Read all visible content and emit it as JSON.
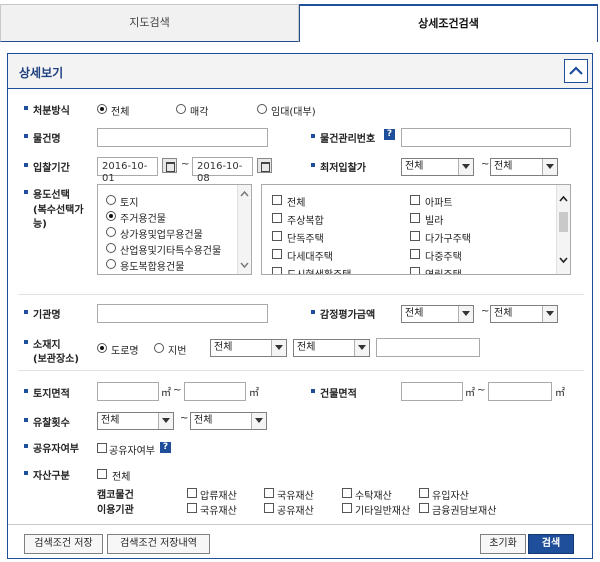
{
  "tabs": {
    "map": "지도검색",
    "detail": "상세조건검색"
  },
  "panel": {
    "title": "상세보기"
  },
  "disposal": {
    "label": "처분방식",
    "options": [
      "전체",
      "매각",
      "임대(대부)"
    ],
    "selected": 0
  },
  "item_name": {
    "label": "물건명",
    "value": ""
  },
  "item_no": {
    "label": "물건관리번호",
    "help": "?",
    "value": ""
  },
  "bid_period": {
    "label": "입찰기간",
    "from": "2016-10-01",
    "to": "2016-10-08",
    "tilde": "~"
  },
  "min_bid": {
    "label": "최저입찰가",
    "from": "전체",
    "to": "전체",
    "tilde": "~"
  },
  "usage": {
    "label": "용도선택",
    "label2": "(복수선택가",
    "label3": "능)",
    "radios": [
      "토지",
      "주거용건물",
      "상가용및업무용건물",
      "산업용및기타특수용건물",
      "용도복합용건물"
    ],
    "selected": 1,
    "checks_left": [
      "전체",
      "주상복합",
      "단독주택",
      "다세대주택",
      "도시형생활주택"
    ],
    "checks_right": [
      "아파트",
      "빌라",
      "다가구주택",
      "다중주택",
      "연립주택"
    ]
  },
  "agency": {
    "label": "기관명",
    "value": ""
  },
  "appraisal": {
    "label": "감정평가금액",
    "from": "전체",
    "to": "전체",
    "tilde": "~"
  },
  "location": {
    "label": "소재지",
    "label2": "(보관장소)",
    "options": [
      "도로명",
      "지번"
    ],
    "selected": 0,
    "sel1": "전체",
    "sel2": "전체",
    "value": ""
  },
  "land_area": {
    "label": "토지면적",
    "unit": "㎡",
    "tilde": "~"
  },
  "bldg_area": {
    "label": "건물면적",
    "unit": "㎡",
    "tilde": "~"
  },
  "fail_count": {
    "label": "유찰횟수",
    "from": "전체",
    "to": "전체",
    "tilde": "~"
  },
  "shared": {
    "label": "공유자여부",
    "check": "공유자여부",
    "help": "?"
  },
  "asset": {
    "label": "자산구분",
    "all": "전체",
    "group1": "캠코물건",
    "group1_items": [
      "압류재산",
      "국유재산",
      "수탁재산",
      "유입자산"
    ],
    "group2": "이용기관",
    "group2_items": [
      "국유재산",
      "공유재산",
      "기타일반재산",
      "금융권담보재산"
    ]
  },
  "buttons": {
    "save_cond": "검색조건 저장",
    "save_hist": "검색조건 저장내역",
    "reset": "초기화",
    "search": "검색"
  },
  "colors": {
    "accent": "#1f4f9a"
  }
}
